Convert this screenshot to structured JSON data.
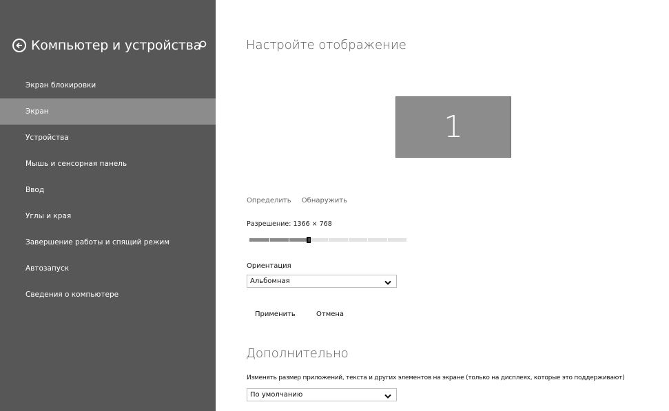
{
  "sidebar": {
    "title": "Компьютер и устройства",
    "back_icon": "back-arrow-icon",
    "search_icon": "search-icon",
    "items": [
      {
        "label": "Экран блокировки",
        "active": false
      },
      {
        "label": "Экран",
        "active": true
      },
      {
        "label": "Устройства",
        "active": false
      },
      {
        "label": "Мышь и сенсорная панель",
        "active": false
      },
      {
        "label": "Ввод",
        "active": false
      },
      {
        "label": "Углы и края",
        "active": false
      },
      {
        "label": "Завершение работы и спящий режим",
        "active": false
      },
      {
        "label": "Автозапуск",
        "active": false
      },
      {
        "label": "Сведения о компьютере",
        "active": false
      }
    ]
  },
  "main": {
    "title": "Настройте отображение",
    "monitor_number": "1",
    "identify_link": "Определить",
    "detect_link": "Обнаружить",
    "resolution_label": "Разрешение: 1366 × 768",
    "resolution_slider": {
      "steps": 8,
      "selected_step": 3
    },
    "orientation_label": "Ориентация",
    "orientation_value": "Альбомная",
    "apply_button": "Применить",
    "cancel_button": "Отмена",
    "advanced_title": "Дополнительно",
    "scale_description": "Изменять размер приложений, текста и других элементов на экране (только на дисплеях, которые это поддерживают)",
    "scale_value": "По умолчанию"
  },
  "colors": {
    "sidebar_bg": "#575757",
    "sidebar_active": "#8c8c8c",
    "monitor_fill": "#8c8c8c"
  }
}
